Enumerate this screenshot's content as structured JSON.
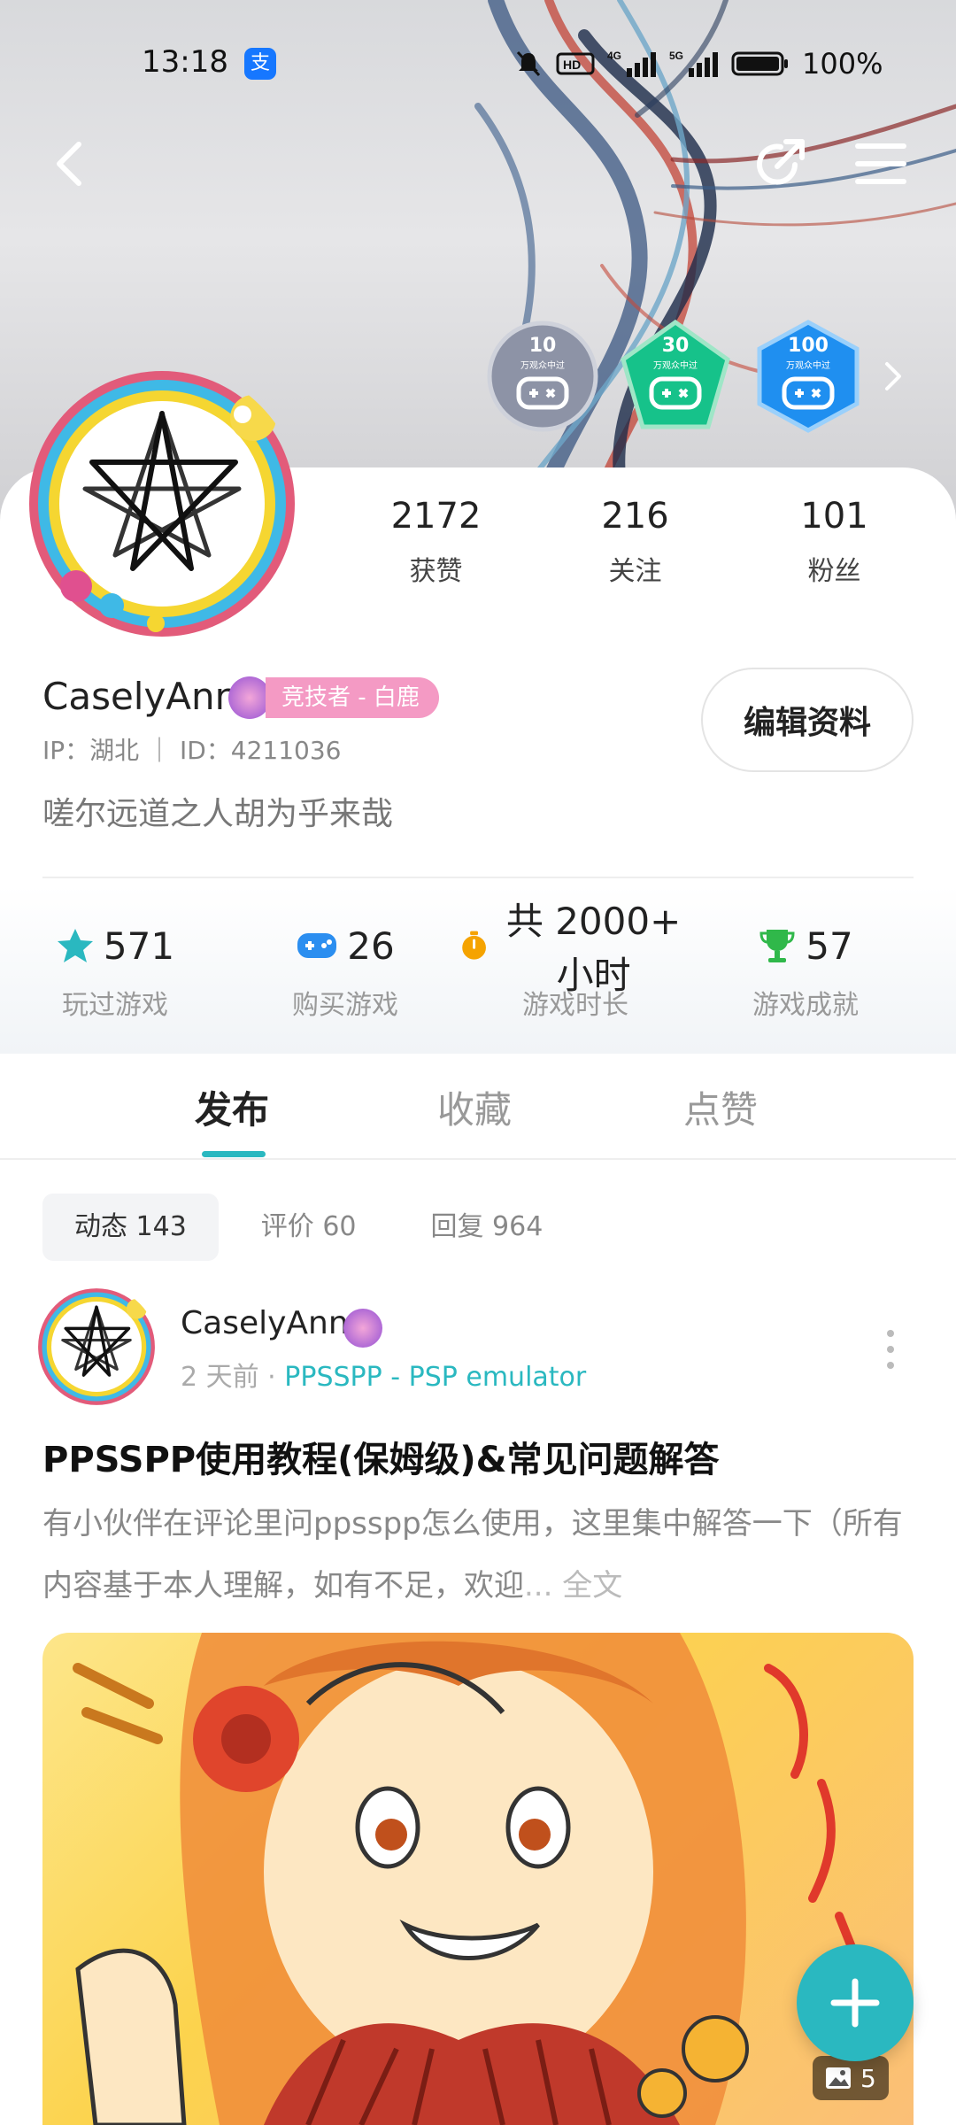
{
  "status_bar": {
    "time": "13:18",
    "battery": "100%"
  },
  "badges": [
    {
      "value": "10",
      "caption": "万观众中过",
      "color": "#8d93a6"
    },
    {
      "value": "30",
      "caption": "万观众中过",
      "color": "#16c28a"
    },
    {
      "value": "100",
      "caption": "万观众中过",
      "color": "#1f8ff0"
    }
  ],
  "profile": {
    "username": "CaselyAnn",
    "rank_tag": "竞技者 - 白鹿",
    "meta": "IP：湖北 ｜ ID：4211036",
    "bio": "嗟尔远道之人胡为乎来哉",
    "edit_button": "编辑资料",
    "counts": [
      {
        "value": "2172",
        "label": "获赞"
      },
      {
        "value": "216",
        "label": "关注"
      },
      {
        "value": "101",
        "label": "粉丝"
      }
    ]
  },
  "game_stats": [
    {
      "value": "571",
      "label": "玩过游戏",
      "icon": "star-icon",
      "color": "#2ab8c0"
    },
    {
      "value": "26",
      "label": "购买游戏",
      "icon": "gamepad-icon",
      "color": "#2b8ef0"
    },
    {
      "value": "共 2000+ 小时",
      "label": "游戏时长",
      "icon": "stopwatch-icon",
      "color": "#f5a300"
    },
    {
      "value": "57",
      "label": "游戏成就",
      "icon": "trophy-icon",
      "color": "#30b84a"
    }
  ],
  "tabs": [
    "发布",
    "收藏",
    "点赞"
  ],
  "subtabs": [
    "动态 143",
    "评价 60",
    "回复 964"
  ],
  "post": {
    "author": "CaselyAnn",
    "time": "2 天前",
    "separator": "·",
    "app": "PPSSPP - PSP emulator",
    "title": "PPSSPP使用教程(保姆级)&常见问题解答",
    "body": "有小伙伴在评论里问ppsspp怎么使用，这里集中解答一下（所有内容基于本人理解，如有不足，欢迎",
    "more_label": "... 全文",
    "image_count": "5"
  }
}
